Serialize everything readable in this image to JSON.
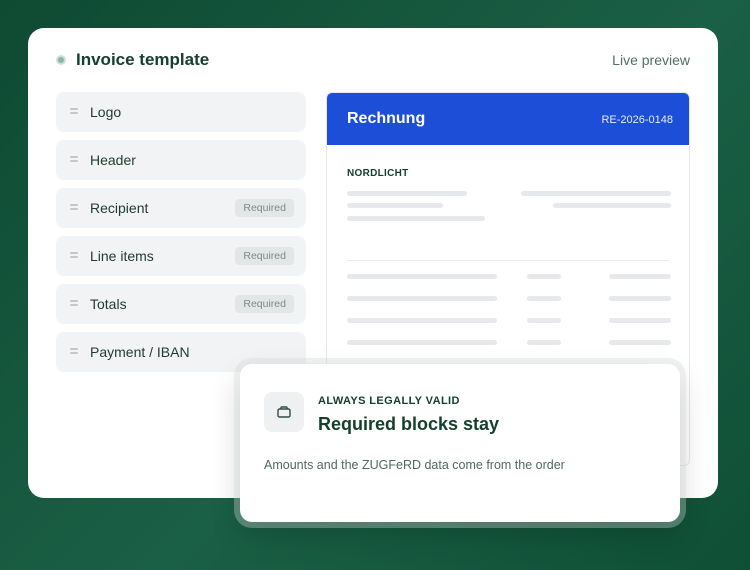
{
  "window": {
    "title": "Invoice template",
    "mode_label": "Live preview"
  },
  "blocks": [
    {
      "label": "Logo",
      "badge": ""
    },
    {
      "label": "Header",
      "badge": ""
    },
    {
      "label": "Recipient",
      "badge": "Required"
    },
    {
      "label": "Line items",
      "badge": "Required"
    },
    {
      "label": "Totals",
      "badge": "Required"
    },
    {
      "label": "Payment / IBAN",
      "badge": ""
    }
  ],
  "preview": {
    "title": "Rechnung",
    "invoice_number": "RE-2026-0148",
    "company": "NORDLICHT"
  },
  "callout": {
    "eyebrow": "ALWAYS LEGALLY VALID",
    "title": "Required blocks stay",
    "description": "Amounts and the ZUGFeRD data come from the order",
    "icon": "wallet-icon"
  },
  "colors": {
    "background": "#14553c",
    "accent_blue": "#1c4ed8",
    "text_dark_green": "#14402d"
  }
}
